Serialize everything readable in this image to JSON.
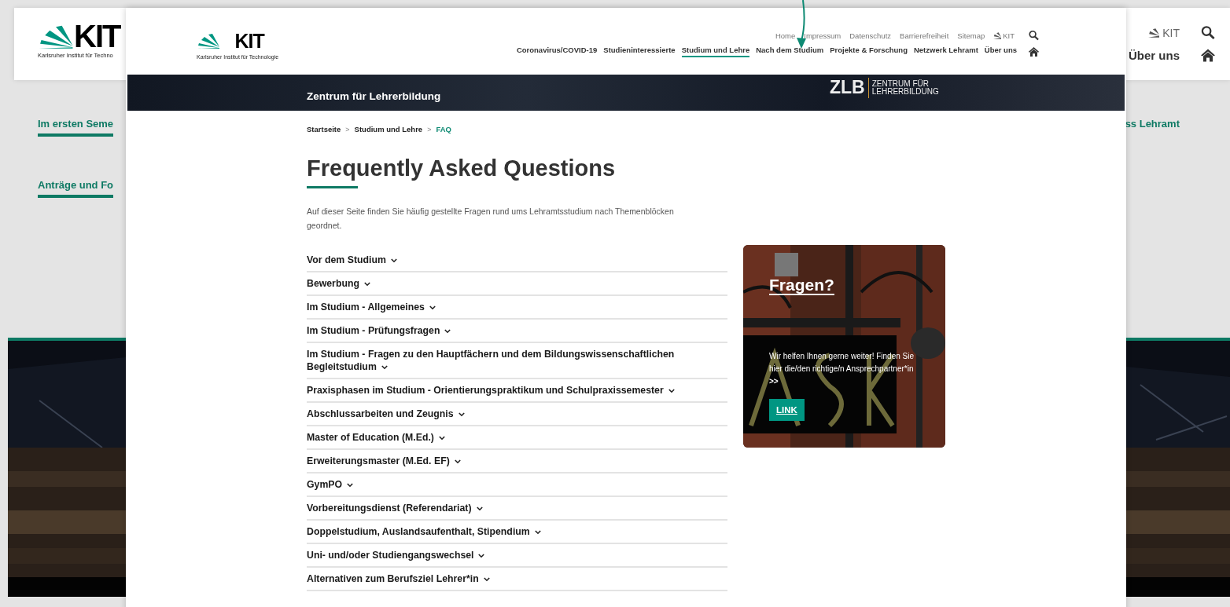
{
  "background_page": {
    "logo": {
      "letters": "KIT",
      "subtitle": "Karlsruher Institut für Techno"
    },
    "utility": {
      "kit_label": "KIT"
    },
    "nav_item": "Über uns",
    "side_links": [
      {
        "label": "Im ersten Seme"
      },
      {
        "label": "Anträge und Fo"
      }
    ],
    "right_link": "ss Lehramt"
  },
  "window": {
    "logo": {
      "letters": "KIT",
      "subtitle": "Karlsruher Institut für Technologie"
    },
    "utility_links": [
      "Home",
      "Impressum",
      "Datenschutz",
      "Barrierefreiheit",
      "Sitemap"
    ],
    "kit_link": "KIT",
    "main_nav": [
      {
        "label": "Coronavirus/COVID-19",
        "selected": false
      },
      {
        "label": "Studieninteressierte",
        "selected": false
      },
      {
        "label": "Studium und Lehre",
        "selected": true
      },
      {
        "label": "Nach dem Studium",
        "selected": false
      },
      {
        "label": "Projekte & Forschung",
        "selected": false
      },
      {
        "label": "Netzwerk Lehramt",
        "selected": false
      },
      {
        "label": "Über uns",
        "selected": false
      }
    ],
    "banner": {
      "title": "Zentrum für Lehrerbildung",
      "logo_letters": "ZLB",
      "logo_line_1": "ZENTRUM FÜR",
      "logo_line_2": "LEHRERBILDUNG"
    },
    "breadcrumb": [
      {
        "label": "Startseite",
        "current": false
      },
      {
        "label": "Studium und Lehre",
        "current": false
      },
      {
        "label": "FAQ",
        "current": true
      }
    ],
    "breadcrumb_separator": ">",
    "title": "Frequently Asked Questions",
    "intro": "Auf dieser Seite finden Sie häufig gestellte Fragen rund ums Lehramtsstudium nach Themenblöcken geordnet.",
    "faq": [
      {
        "label": "Vor dem Studium",
        "expanded": false
      },
      {
        "label": "Bewerbung",
        "expanded": false
      },
      {
        "label": "Im Studium - Allgemeines",
        "expanded": false
      },
      {
        "label": "Im Studium - Prüfungsfragen",
        "expanded": false
      },
      {
        "label": "Im Studium - Fragen zu den Hauptfächern und dem Bildungswissenschaftlichen Begleitstudium",
        "expanded": false
      },
      {
        "label": "Praxisphasen im Studium - Orientierungspraktikum und Schulpraxissemester",
        "expanded": false
      },
      {
        "label": "Abschlussarbeiten und Zeugnis",
        "expanded": false
      },
      {
        "label": "Master of Education (M.Ed.)",
        "expanded": false
      },
      {
        "label": "Erweiterungsmaster (M.Ed. EF)",
        "expanded": false
      },
      {
        "label": "GymPO",
        "expanded": false
      },
      {
        "label": "Vorbereitungsdienst (Referendariat)",
        "expanded": false
      },
      {
        "label": "Doppelstudium, Auslandsaufenthalt, Stipendium",
        "expanded": false
      },
      {
        "label": "Uni- und/oder Studiengangswechsel",
        "expanded": false
      },
      {
        "label": "Alternativen zum Berufsziel Lehrer*in",
        "expanded": false
      }
    ],
    "card": {
      "title": "Fragen?",
      "text": "Wir helfen Ihnen gerne weiter! Finden Sie hier die/den richtige/n Ansprechpartner*in **>>**",
      "button": "LINK"
    }
  }
}
